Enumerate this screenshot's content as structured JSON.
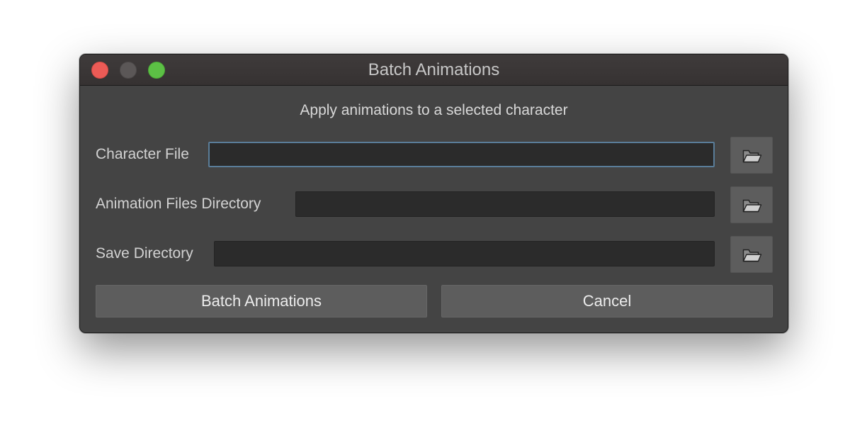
{
  "window": {
    "title": "Batch Animations"
  },
  "dialog": {
    "subtitle": "Apply animations to a selected character",
    "fields": [
      {
        "label": "Character File",
        "value": "",
        "browse_icon": "folder-open-icon"
      },
      {
        "label": "Animation Files Directory",
        "value": "",
        "browse_icon": "folder-open-icon"
      },
      {
        "label": "Save Directory",
        "value": "",
        "browse_icon": "folder-open-icon"
      }
    ],
    "buttons": {
      "primary_label": "Batch Animations",
      "cancel_label": "Cancel"
    }
  },
  "colors": {
    "close": "#ec5b56",
    "minimize": "#5b5757",
    "zoom": "#5cc045",
    "window_bg": "#444444",
    "field_bg": "#2b2b2b",
    "focus_border": "#5a7d99"
  }
}
